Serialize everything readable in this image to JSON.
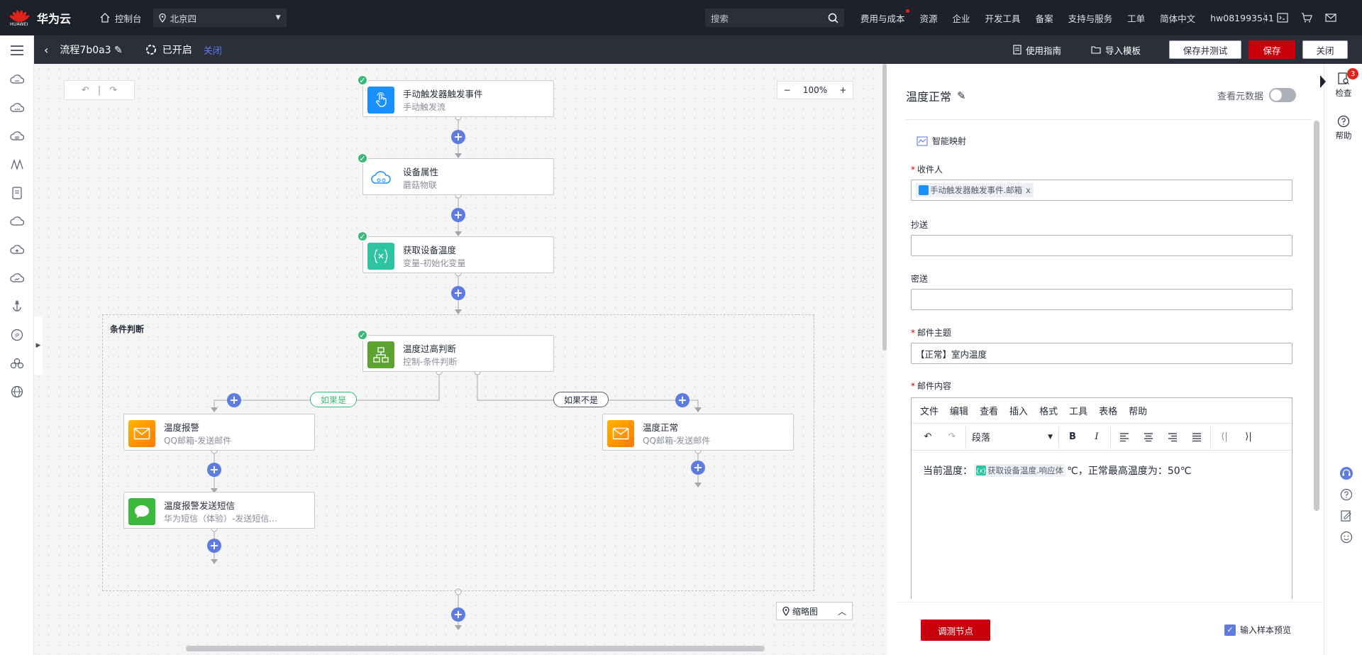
{
  "topbar": {
    "logo_caption": "HUAWEI",
    "brand": "华为云",
    "console": "控制台",
    "region": "北京四",
    "search_placeholder": "搜索",
    "links": [
      "费用与成本",
      "资源",
      "企业",
      "开发工具",
      "备案",
      "支持与服务",
      "工单",
      "简体中文",
      "hw081993541"
    ]
  },
  "subbar": {
    "flow_name": "流程7b0a3",
    "status": "已开启",
    "off_label": "关闭",
    "guide": "使用指南",
    "import": "导入模板",
    "save_test": "保存并测试",
    "save": "保存",
    "close": "关闭"
  },
  "canvas": {
    "zoom": "100%",
    "group_label": "条件判断",
    "if_yes": "如果是",
    "if_no": "如果不是",
    "minimap": "缩略图",
    "nodes": [
      {
        "title": "手动触发器触发事件",
        "subtitle": "手动触发流"
      },
      {
        "title": "设备属性",
        "subtitle": "蘑菇物联"
      },
      {
        "title": "获取设备温度",
        "subtitle": "变量-初始化变量"
      },
      {
        "title": "温度过高判断",
        "subtitle": "控制-条件判断"
      },
      {
        "title": "温度报警",
        "subtitle": "QQ邮箱-发送邮件"
      },
      {
        "title": "温度报警发送短信",
        "subtitle": "华为短信（体验）-发送短信..."
      },
      {
        "title": "温度正常",
        "subtitle": "QQ邮箱-发送邮件"
      }
    ]
  },
  "panel": {
    "title": "温度正常",
    "meta_label": "查看元数据",
    "smart_map": "智能映射",
    "recipient_label": "收件人",
    "recipient_chip": "手动触发器触发事件.邮箱",
    "cc_label": "抄送",
    "bcc_label": "密送",
    "subject_label": "邮件主题",
    "subject_value": "【正常】室内温度",
    "content_label": "邮件内容",
    "menu": [
      "文件",
      "编辑",
      "查看",
      "插入",
      "格式",
      "工具",
      "表格",
      "帮助"
    ],
    "format_select": "段落",
    "body_prefix": "当前温度：",
    "body_var": "获取设备温度.响应体",
    "body_suffix": "℃，正常最高温度为：50℃",
    "debug_button": "调测节点",
    "sample_preview": "输入样本预览"
  },
  "rightrail": {
    "inspect": "检查",
    "inspect_badge": "3",
    "help": "帮助"
  },
  "colors": {
    "brand_red": "#c7000b",
    "accent_blue": "#5e7ce0",
    "success_green": "#3cb878"
  }
}
